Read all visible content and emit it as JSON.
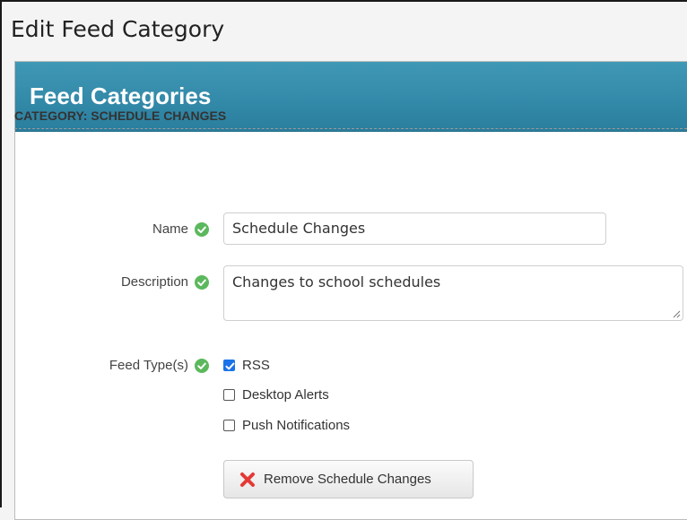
{
  "page": {
    "title": "Edit Feed Category"
  },
  "panel": {
    "title": "Feed Categories"
  },
  "section": {
    "title": "CATEGORY: SCHEDULE CHANGES"
  },
  "form": {
    "name": {
      "label": "Name",
      "value": "Schedule Changes"
    },
    "description": {
      "label": "Description",
      "value": "Changes to school schedules"
    },
    "feed_types": {
      "label": "Feed Type(s)",
      "options": [
        {
          "label": "RSS",
          "checked": true
        },
        {
          "label": "Desktop Alerts",
          "checked": false
        },
        {
          "label": "Push Notifications",
          "checked": false
        }
      ]
    }
  },
  "actions": {
    "remove_label": "Remove Schedule Changes"
  },
  "icons": {
    "valid": "check-circle-icon",
    "remove": "x-icon",
    "resize": "resize-grip-icon"
  },
  "colors": {
    "header": "#2f87a7",
    "valid": "#5cb85c",
    "remove": "#e53935",
    "checkbox_checked": "#1a73e8"
  }
}
